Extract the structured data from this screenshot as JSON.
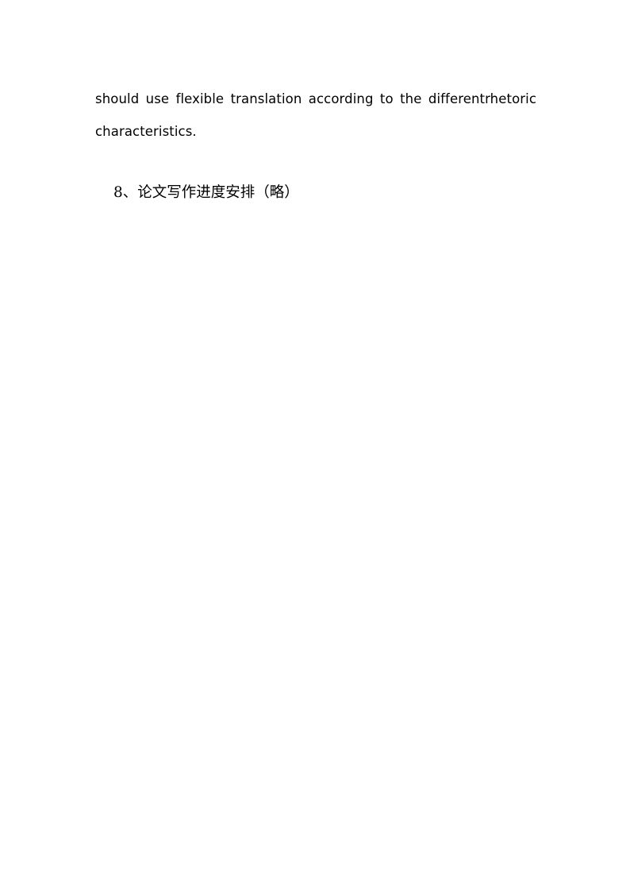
{
  "document": {
    "page_background": "#ffffff",
    "text_color": "#000000",
    "body_paragraph": {
      "line_1": "should use flexible translation according to the differentrhetoric",
      "line_2": "characteristics."
    },
    "heading": {
      "text": "8、论文写作进度安排（略）"
    }
  }
}
